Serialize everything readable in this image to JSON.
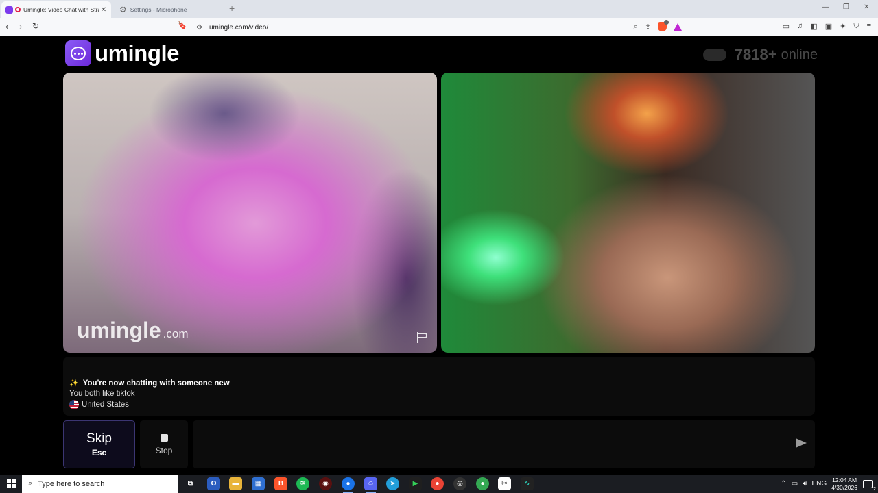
{
  "browser": {
    "tabs": [
      {
        "title": "Umingle: Video Chat with Strangers",
        "active": true
      },
      {
        "title": "Settings - Microphone",
        "active": false
      }
    ],
    "new_tab_icon": "+",
    "url": "umingle.com/video/",
    "window_controls": {
      "minimize": "—",
      "restore": "❐",
      "close": "✕"
    }
  },
  "page": {
    "logo_text": "umingle",
    "online_count": "7818+",
    "online_label": "online",
    "watermark_main": "umingle",
    "watermark_sub": ".com",
    "chat": {
      "system_message": "You're now chatting with someone new",
      "common_interest": "You both like tiktok",
      "country": "United States"
    },
    "controls": {
      "skip_label": "Skip",
      "skip_key": "Esc",
      "stop_label": "Stop",
      "message_placeholder": ""
    },
    "colors": {
      "accent": "#7c3aed",
      "background": "#000000"
    }
  },
  "taskbar": {
    "search_placeholder": "Type here to search",
    "language": "ENG",
    "time": "12:04 AM",
    "date": "4/30/2026",
    "notification_count": "2",
    "apps": [
      "task-view",
      "outlook",
      "file-explorer",
      "microsoft-store",
      "brave",
      "spotify",
      "davinci",
      "chrome",
      "discord",
      "telegram",
      "app-green",
      "chrome",
      "obs",
      "chrome",
      "capcut",
      "waveform-app"
    ]
  }
}
